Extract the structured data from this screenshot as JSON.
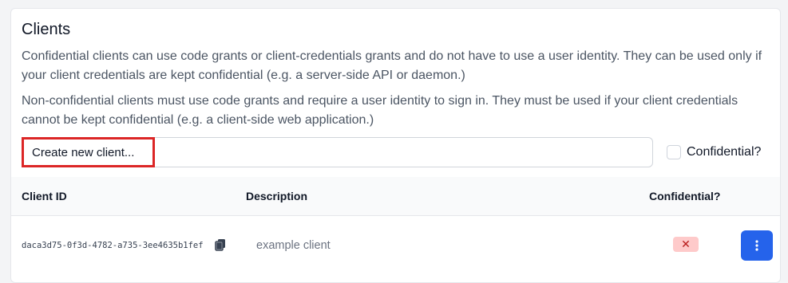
{
  "section": {
    "title": "Clients",
    "paragraph_confidential": "Confidential clients can use code grants or client-credentials grants and do not have to use a user identity. They can be used only if your client credentials are kept confidential (e.g. a server-side API or daemon.)",
    "paragraph_nonconfidential": "Non-confidential clients must use code grants and require a user identity to sign in. They must be used if your client credentials cannot be kept confidential (e.g. a client-side web application.)"
  },
  "form": {
    "new_client_placeholder": "Create new client...",
    "confidential_label": "Confidential?",
    "confidential_checked": false
  },
  "table": {
    "headers": [
      "Client ID",
      "Description",
      "Confidential?"
    ],
    "rows": [
      {
        "client_id": "daca3d75-0f3d-4782-a735-3ee4635b1fef",
        "description": "example client",
        "confidential_mark": "✕",
        "confidential": false
      }
    ]
  },
  "icons": {
    "copy": "copy-icon",
    "menu": "vertical-ellipsis-icon"
  },
  "colors": {
    "accent": "#2563eb",
    "highlight": "#dc2626",
    "badge_bg": "#fecaca",
    "badge_fg": "#b91c1c"
  }
}
